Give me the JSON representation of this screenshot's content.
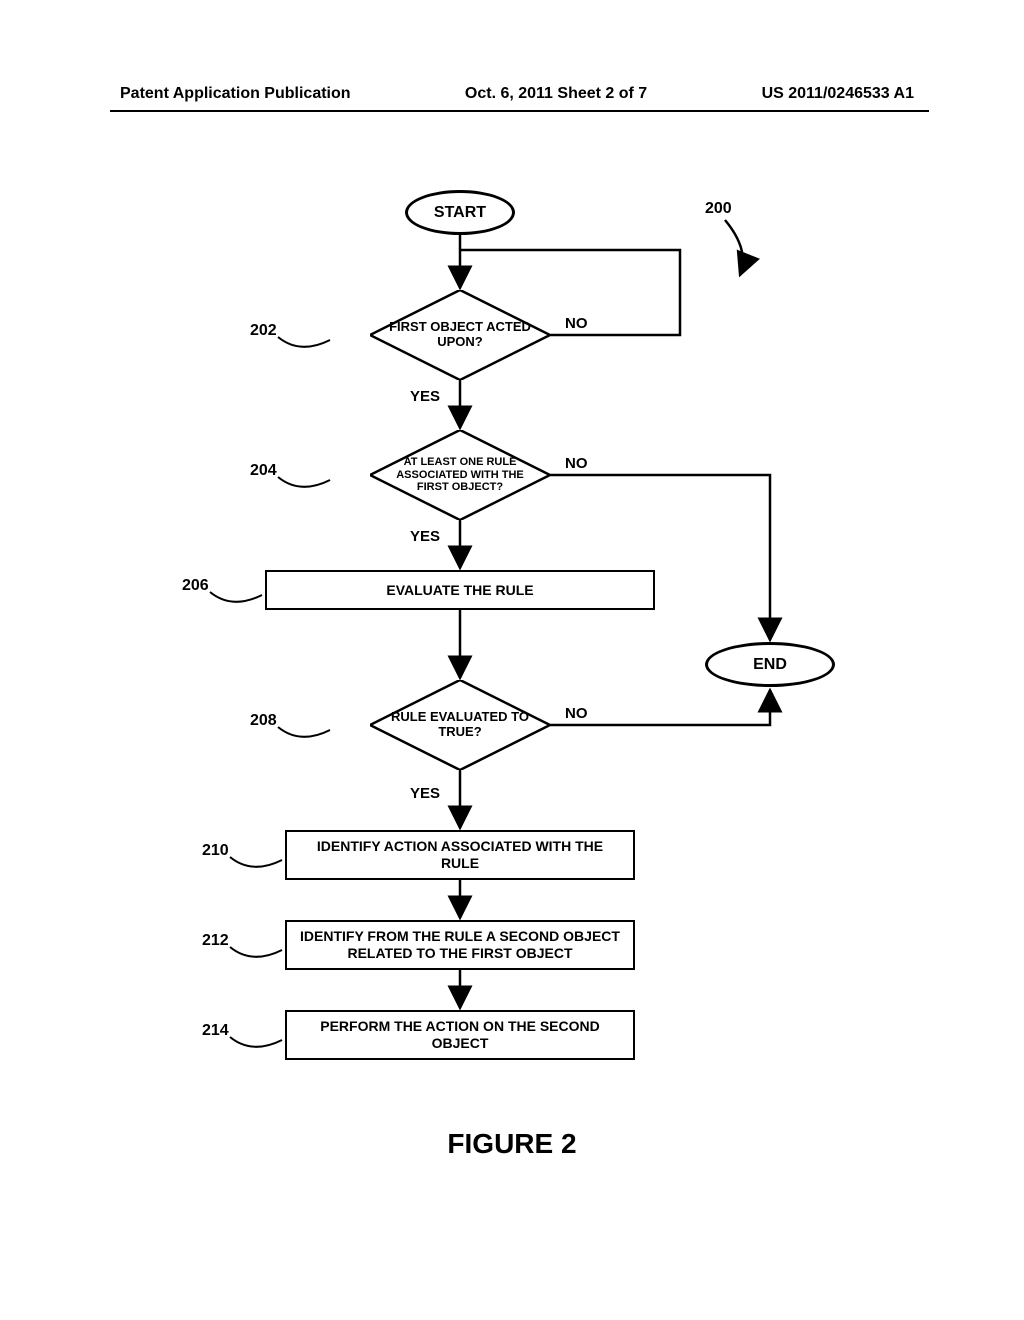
{
  "header": {
    "left": "Patent Application Publication",
    "center": "Oct. 6, 2011  Sheet 2 of 7",
    "right": "US 2011/0246533 A1"
  },
  "refs": {
    "r200": "200",
    "r202": "202",
    "r204": "204",
    "r206": "206",
    "r208": "208",
    "r210": "210",
    "r212": "212",
    "r214": "214"
  },
  "nodes": {
    "start": "START",
    "end": "END",
    "d202": "FIRST OBJECT ACTED UPON?",
    "d204": "AT LEAST ONE RULE ASSOCIATED WITH THE FIRST OBJECT?",
    "p206": "EVALUATE THE RULE",
    "d208": "RULE EVALUATED TO TRUE?",
    "p210": "IDENTIFY ACTION ASSOCIATED WITH THE RULE",
    "p212": "IDENTIFY FROM THE RULE A SECOND OBJECT RELATED TO THE FIRST OBJECT",
    "p214": "PERFORM THE ACTION ON THE SECOND OBJECT"
  },
  "labels": {
    "yes": "YES",
    "no": "NO"
  },
  "figure": "FIGURE 2",
  "chart_data": {
    "type": "flowchart",
    "nodes": [
      {
        "id": "start",
        "type": "terminal",
        "label": "START"
      },
      {
        "id": "202",
        "type": "decision",
        "label": "FIRST OBJECT ACTED UPON?"
      },
      {
        "id": "204",
        "type": "decision",
        "label": "AT LEAST ONE RULE ASSOCIATED WITH THE FIRST OBJECT?"
      },
      {
        "id": "206",
        "type": "process",
        "label": "EVALUATE THE RULE"
      },
      {
        "id": "208",
        "type": "decision",
        "label": "RULE EVALUATED TO TRUE?"
      },
      {
        "id": "210",
        "type": "process",
        "label": "IDENTIFY ACTION ASSOCIATED WITH THE RULE"
      },
      {
        "id": "212",
        "type": "process",
        "label": "IDENTIFY FROM THE RULE A SECOND OBJECT RELATED TO THE FIRST OBJECT"
      },
      {
        "id": "214",
        "type": "process",
        "label": "PERFORM THE ACTION ON THE SECOND OBJECT"
      },
      {
        "id": "end",
        "type": "terminal",
        "label": "END"
      }
    ],
    "edges": [
      {
        "from": "start",
        "to": "202"
      },
      {
        "from": "202",
        "to": "204",
        "label": "YES"
      },
      {
        "from": "202",
        "to": "start",
        "label": "NO",
        "loopback": true
      },
      {
        "from": "204",
        "to": "206",
        "label": "YES"
      },
      {
        "from": "204",
        "to": "end",
        "label": "NO"
      },
      {
        "from": "206",
        "to": "208"
      },
      {
        "from": "208",
        "to": "210",
        "label": "YES"
      },
      {
        "from": "208",
        "to": "end",
        "label": "NO"
      },
      {
        "from": "210",
        "to": "212"
      },
      {
        "from": "212",
        "to": "214"
      }
    ],
    "reference_numeral": "200",
    "title": "FIGURE 2"
  }
}
